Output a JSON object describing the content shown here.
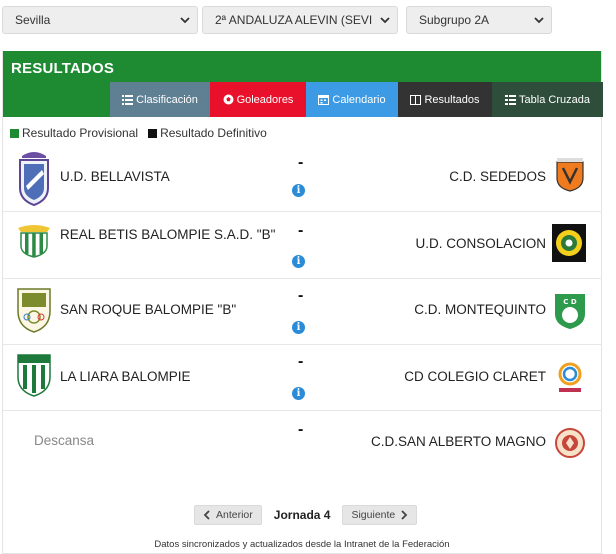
{
  "filters": {
    "province": "Sevilla",
    "competition": "2ª ANDALUZA ALEVIN (SEVI",
    "group": "Subgrupo 2A"
  },
  "panel": {
    "title": "RESULTADOS"
  },
  "tabs": [
    {
      "label": "Clasificación",
      "icon": "list-icon",
      "color": "#5f7f93"
    },
    {
      "label": "Goleadores",
      "icon": "soccer-ball-icon",
      "color": "#e8102a"
    },
    {
      "label": "Calendario",
      "icon": "calendar-icon",
      "color": "#3c9be4"
    },
    {
      "label": "Resultados",
      "icon": "window-icon",
      "color": "#333333"
    },
    {
      "label": "Tabla Cruzada",
      "icon": "table-icon",
      "color": "#2e4d3a"
    }
  ],
  "legend": {
    "provisional": "Resultado Provisional",
    "definitivo": "Resultado Definitivo",
    "provisional_color": "#1e8b32",
    "definitivo_color": "#111111"
  },
  "matches": [
    {
      "home": "U.D. BELLAVISTA",
      "away": "C.D. SEDEDOS",
      "score": "-",
      "info": "i"
    },
    {
      "home": "REAL BETIS BALOMPIE S.A.D. \"B\"",
      "away": "U.D. CONSOLACION",
      "score": "-",
      "info": "i"
    },
    {
      "home": "SAN ROQUE BALOMPIE \"B\"",
      "away": "C.D. MONTEQUINTO",
      "score": "-",
      "info": "i"
    },
    {
      "home": "LA LIARA BALOMPIE",
      "away": "CD COLEGIO CLARET",
      "score": "-",
      "info": "i"
    },
    {
      "home": "Descansa",
      "away": "C.D.SAN ALBERTO MAGNO",
      "score": "-"
    }
  ],
  "pager": {
    "prev": "Anterior",
    "label": "Jornada 4",
    "next": "Siguiente"
  },
  "footer": "Datos sincronizados y actualizados desde la Intranet de la Federación"
}
